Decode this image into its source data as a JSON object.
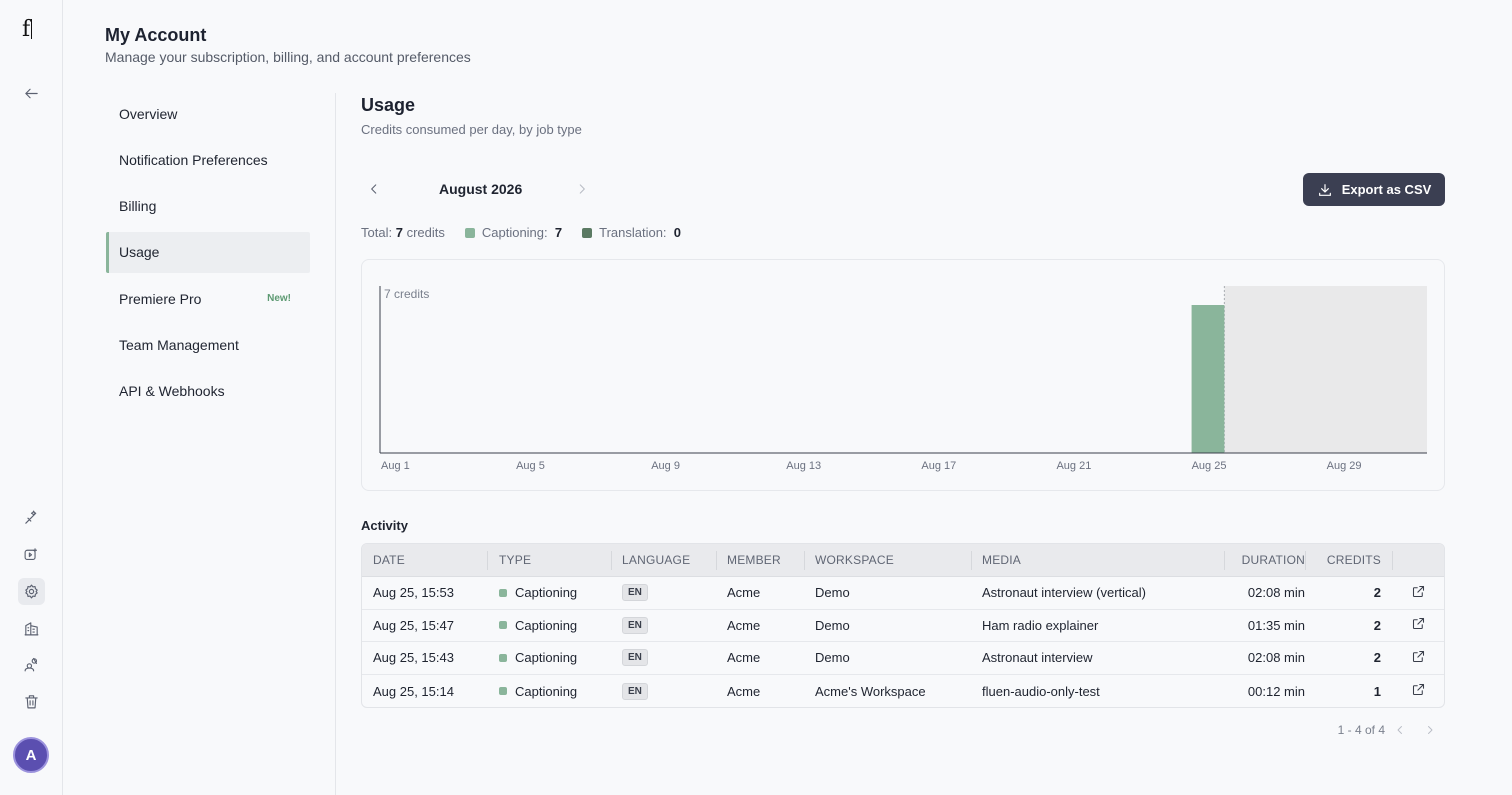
{
  "app": {
    "logo_text": "f"
  },
  "header": {
    "title": "My Account",
    "subtitle": "Manage your subscription, billing, and account preferences"
  },
  "rail": {
    "icons": [
      "back-arrow-icon",
      "wand-icon",
      "video-icon",
      "settings-icon",
      "building-icon",
      "users-icon",
      "trash-icon"
    ],
    "avatar_initial": "A"
  },
  "nav": {
    "items": [
      {
        "label": "Overview"
      },
      {
        "label": "Notification Preferences"
      },
      {
        "label": "Billing"
      },
      {
        "label": "Usage",
        "active": true
      },
      {
        "label": "Premiere Pro",
        "badge": "New!"
      },
      {
        "label": "Team Management"
      },
      {
        "label": "API & Webhooks"
      }
    ]
  },
  "usage": {
    "title": "Usage",
    "subtitle": "Credits consumed per day, by job type",
    "month": "August 2026",
    "export_label": "Export as CSV",
    "totals": {
      "total_label": "Total:",
      "total_value": "7",
      "total_unit": "credits",
      "captioning_label": "Captioning:",
      "captioning_value": "7",
      "translation_label": "Translation:",
      "translation_value": "0"
    }
  },
  "colors": {
    "captioning": "#8ab59b",
    "translation": "#5b7a63",
    "export_button": "#3b3f52",
    "future_shade": "#e9e9ea"
  },
  "chart_data": {
    "type": "bar",
    "ylabel_annotation": "7 credits",
    "ylim": [
      0,
      7
    ],
    "days_in_month": 31,
    "current_day": 25,
    "x_ticks": [
      "Aug 1",
      "Aug 5",
      "Aug 9",
      "Aug 13",
      "Aug 17",
      "Aug 21",
      "Aug 25",
      "Aug 29"
    ],
    "x_tick_days": [
      1,
      5,
      9,
      13,
      17,
      21,
      25,
      29
    ],
    "series": [
      {
        "name": "Captioning",
        "values": [
          0,
          0,
          0,
          0,
          0,
          0,
          0,
          0,
          0,
          0,
          0,
          0,
          0,
          0,
          0,
          0,
          0,
          0,
          0,
          0,
          0,
          0,
          0,
          0,
          7,
          0,
          0,
          0,
          0,
          0,
          0
        ]
      },
      {
        "name": "Translation",
        "values": [
          0,
          0,
          0,
          0,
          0,
          0,
          0,
          0,
          0,
          0,
          0,
          0,
          0,
          0,
          0,
          0,
          0,
          0,
          0,
          0,
          0,
          0,
          0,
          0,
          0,
          0,
          0,
          0,
          0,
          0,
          0
        ]
      }
    ]
  },
  "activity": {
    "title": "Activity",
    "columns": [
      "DATE",
      "TYPE",
      "LANGUAGE",
      "MEMBER",
      "WORKSPACE",
      "MEDIA",
      "DURATION",
      "CREDITS"
    ],
    "rows": [
      {
        "date": "Aug 25, 15:53",
        "type": "Captioning",
        "language": "EN",
        "member": "Acme",
        "workspace": "Demo",
        "media": "Astronaut interview (vertical)",
        "duration": "02:08 min",
        "credits": "2"
      },
      {
        "date": "Aug 25, 15:47",
        "type": "Captioning",
        "language": "EN",
        "member": "Acme",
        "workspace": "Demo",
        "media": "Ham radio explainer",
        "duration": "01:35 min",
        "credits": "2"
      },
      {
        "date": "Aug 25, 15:43",
        "type": "Captioning",
        "language": "EN",
        "member": "Acme",
        "workspace": "Demo",
        "media": "Astronaut interview",
        "duration": "02:08 min",
        "credits": "2"
      },
      {
        "date": "Aug 25, 15:14",
        "type": "Captioning",
        "language": "EN",
        "member": "Acme",
        "workspace": "Acme's Workspace",
        "media": "fluen-audio-only-test",
        "duration": "00:12 min",
        "credits": "1"
      }
    ],
    "pagination": "1 - 4 of 4"
  }
}
